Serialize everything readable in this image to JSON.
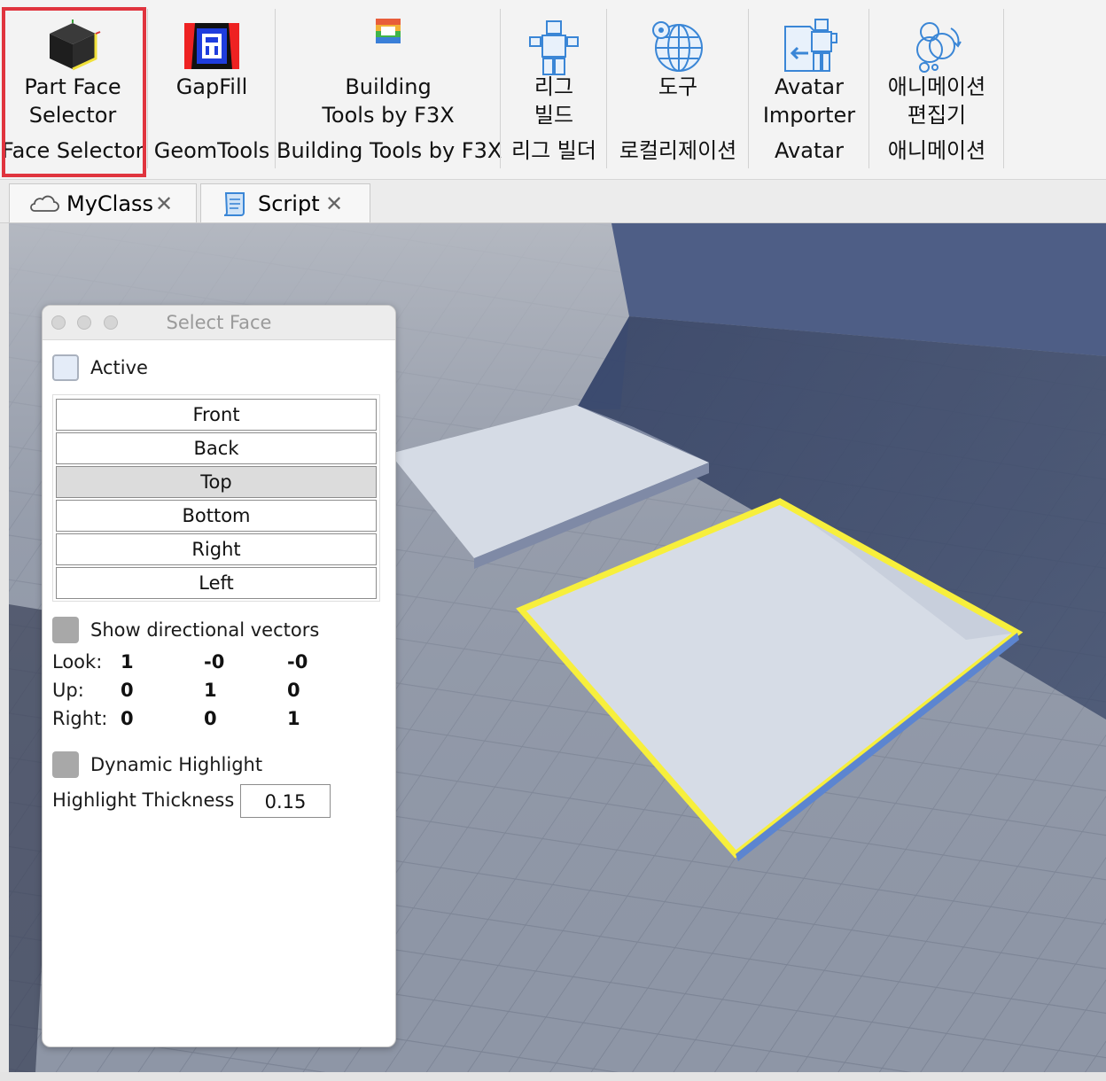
{
  "toolbar": {
    "plugins": [
      {
        "name": "Part Face\nSelector",
        "group": "Face Selector",
        "icon": "cube-icon"
      },
      {
        "name": "GapFill",
        "group": "GeomTools",
        "icon": "gapfill-icon"
      },
      {
        "name": "Building\nTools by F3X",
        "group": "Building Tools by F3X",
        "icon": "f3x-icon"
      },
      {
        "name": "리그\n빌드",
        "group": "리그 빌더",
        "icon": "rig-icon"
      },
      {
        "name": "도구",
        "group": "로컬리제이션",
        "icon": "globe-icon"
      },
      {
        "name": "Avatar\nImporter",
        "group": "Avatar",
        "icon": "avatar-import-icon"
      },
      {
        "name": "애니메이션\n편집기",
        "group": "애니메이션",
        "icon": "animation-icon"
      }
    ],
    "highlight_color": "#e0343e"
  },
  "tabs": [
    {
      "label": "MyClass",
      "icon": "cloud-icon",
      "close": "✕"
    },
    {
      "label": "Script",
      "icon": "script-icon",
      "close": "✕"
    }
  ],
  "panel": {
    "title": "Select Face",
    "active_label": "Active",
    "active_checked": false,
    "faces": [
      "Front",
      "Back",
      "Top",
      "Bottom",
      "Right",
      "Left"
    ],
    "selected_face": "Top",
    "show_vectors_label": "Show directional vectors",
    "vectors": [
      {
        "label": "Look:",
        "values": [
          "1",
          "-0",
          "-0"
        ]
      },
      {
        "label": "Up:",
        "values": [
          "0",
          "1",
          "0"
        ]
      },
      {
        "label": "Right:",
        "values": [
          "0",
          "0",
          "1"
        ]
      }
    ],
    "dynamic_label": "Dynamic Highlight",
    "thickness_label": "Highlight Thickness",
    "thickness_value": "0.15"
  },
  "scene": {
    "wall_color": "#4e5e86",
    "floor_color": "#8c94a4",
    "part_color": "#d3d9e4",
    "highlight_color": "#f7ef3c"
  }
}
